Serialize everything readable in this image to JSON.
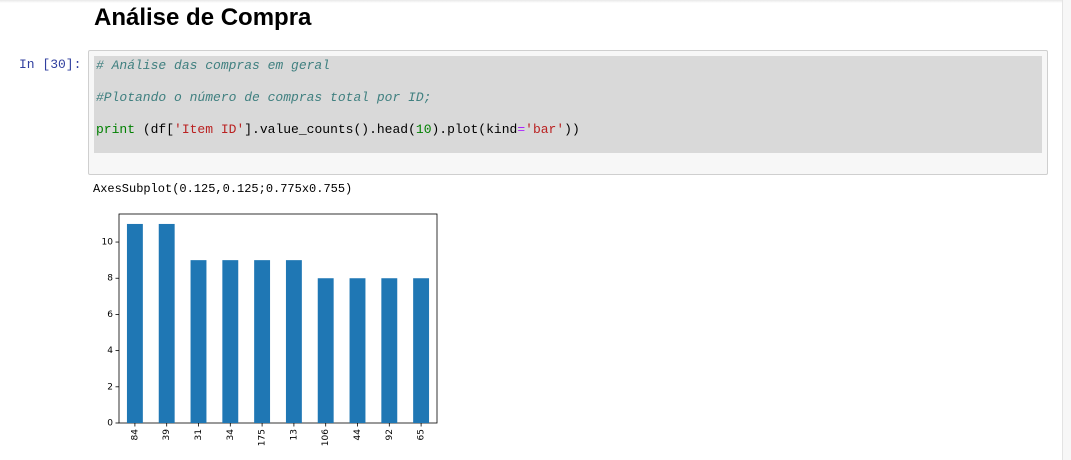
{
  "notebook": {
    "heading": "Análise de Compra",
    "cell": {
      "prompt": "In [30]:",
      "code": {
        "comment1": "# Análise das compras em geral",
        "comment2": "#Plotando o número de compras total por ID;",
        "tokens": {
          "print_kw": "print",
          "t1": " (df[",
          "str1": "'Item ID'",
          "t2": "].value_counts().head(",
          "num1": "10",
          "t3": ").plot(kind",
          "op1": "=",
          "str2": "'bar'",
          "t4": "))"
        }
      },
      "output_text": "AxesSubplot(0.125,0.125;0.775x0.755)"
    }
  },
  "colors": {
    "bar": "#1f77b4",
    "prompt": "#303f9f",
    "code_bg": "#d9d9d9"
  },
  "chart_data": {
    "type": "bar",
    "categories": [
      "84",
      "39",
      "31",
      "34",
      "175",
      "13",
      "106",
      "44",
      "92",
      "65"
    ],
    "values": [
      11,
      11,
      9,
      9,
      9,
      9,
      8,
      8,
      8,
      8
    ],
    "yticks": [
      0,
      2,
      4,
      6,
      8,
      10
    ],
    "ylim": [
      0,
      11.55
    ],
    "title": "",
    "xlabel": "",
    "ylabel": "",
    "grid": false,
    "legend": false
  }
}
